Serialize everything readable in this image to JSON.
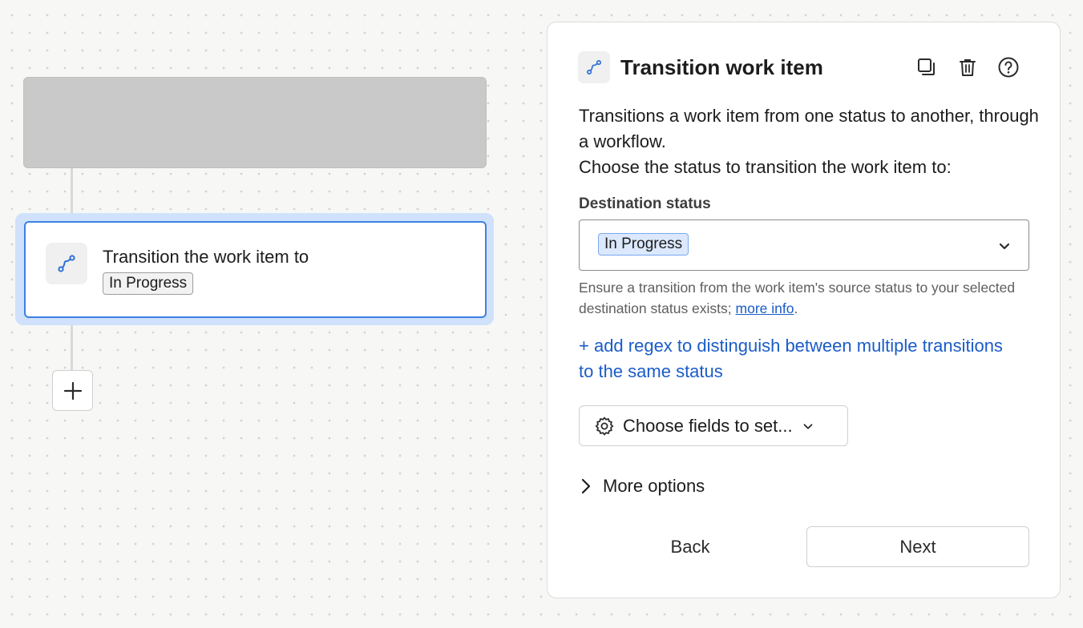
{
  "canvas": {
    "node": {
      "title": "Transition the work item to",
      "status": "In Progress",
      "icon": "transition-path-icon"
    },
    "add_step_icon": "plus-icon"
  },
  "panel": {
    "title": "Transition work item",
    "icons": {
      "title": "transition-path-icon",
      "duplicate": "duplicate-icon",
      "delete": "trash-icon",
      "help": "help-icon"
    },
    "description": [
      "Transitions a work item from one status to another, through a workflow.",
      "Choose the status to transition the work item to:"
    ],
    "destination": {
      "label": "Destination status",
      "value": "In Progress"
    },
    "helper": {
      "text": "Ensure a transition from the work item's source status to your selected destination status exists;",
      "link": "more info",
      "suffix": "."
    },
    "regex_link": "+ add regex to distinguish between multiple transitions to the same status",
    "choose_fields": "Choose fields to set...",
    "more_options": "More options",
    "back": "Back",
    "next": "Next"
  },
  "colors": {
    "accent": "#3b82e0",
    "link": "#1a5cc9",
    "lozenge_selected_bg": "#dbe8fd"
  }
}
